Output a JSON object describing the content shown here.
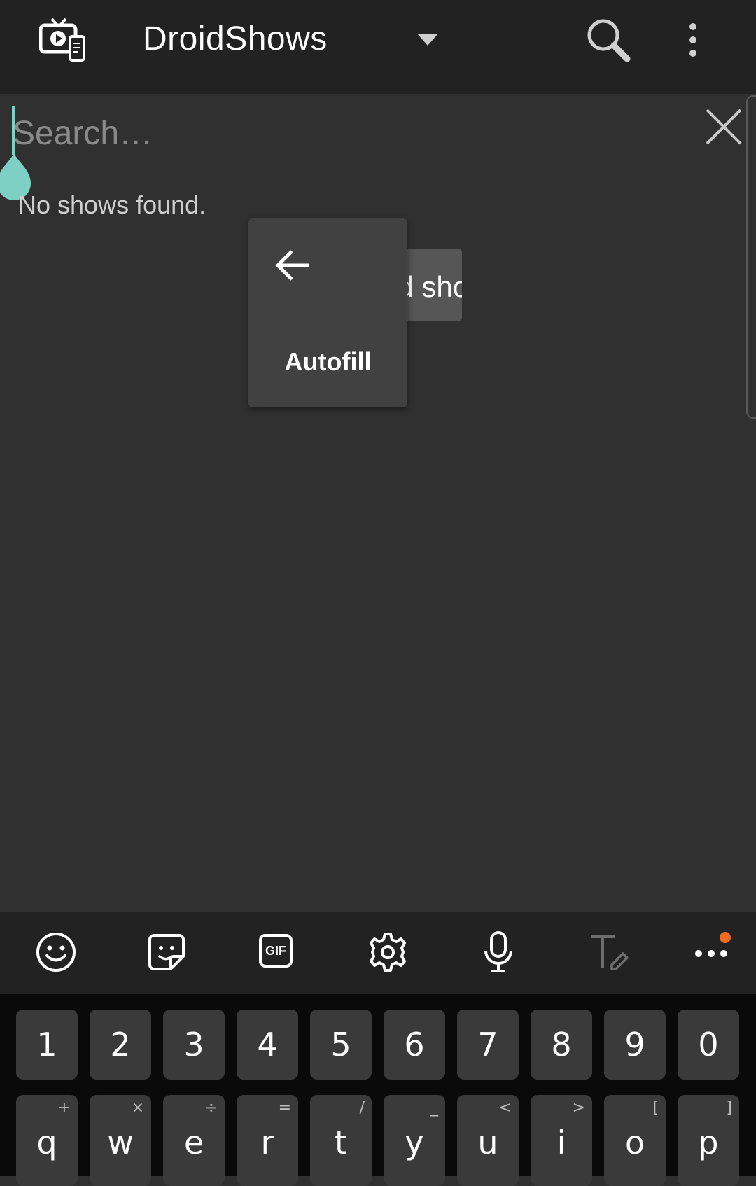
{
  "app_bar": {
    "title": "DroidShows"
  },
  "search": {
    "placeholder": "Search…",
    "value": ""
  },
  "empty_message": "No shows found.",
  "popup_partial_label": "Add show",
  "autofill_menu": {
    "label": "Autofill"
  },
  "keyboard_toolbar": {
    "icons": [
      "emoji-icon",
      "sticker-icon",
      "gif-icon",
      "settings-icon",
      "microphone-icon",
      "text-edit-icon",
      "more-icon"
    ],
    "gif_label": "GIF",
    "notification_color": "#f36b21"
  },
  "keyboard": {
    "number_row": [
      "1",
      "2",
      "3",
      "4",
      "5",
      "6",
      "7",
      "8",
      "9",
      "0"
    ],
    "letter_row": [
      {
        "key": "q",
        "hint": "+"
      },
      {
        "key": "w",
        "hint": "×"
      },
      {
        "key": "e",
        "hint": "÷"
      },
      {
        "key": "r",
        "hint": "="
      },
      {
        "key": "t",
        "hint": "/"
      },
      {
        "key": "y",
        "hint": "_"
      },
      {
        "key": "u",
        "hint": "<"
      },
      {
        "key": "i",
        "hint": ">"
      },
      {
        "key": "o",
        "hint": "["
      },
      {
        "key": "p",
        "hint": "]"
      }
    ]
  },
  "colors": {
    "accent": "#7fd0c4",
    "appbar": "#222222",
    "background": "#303030"
  }
}
